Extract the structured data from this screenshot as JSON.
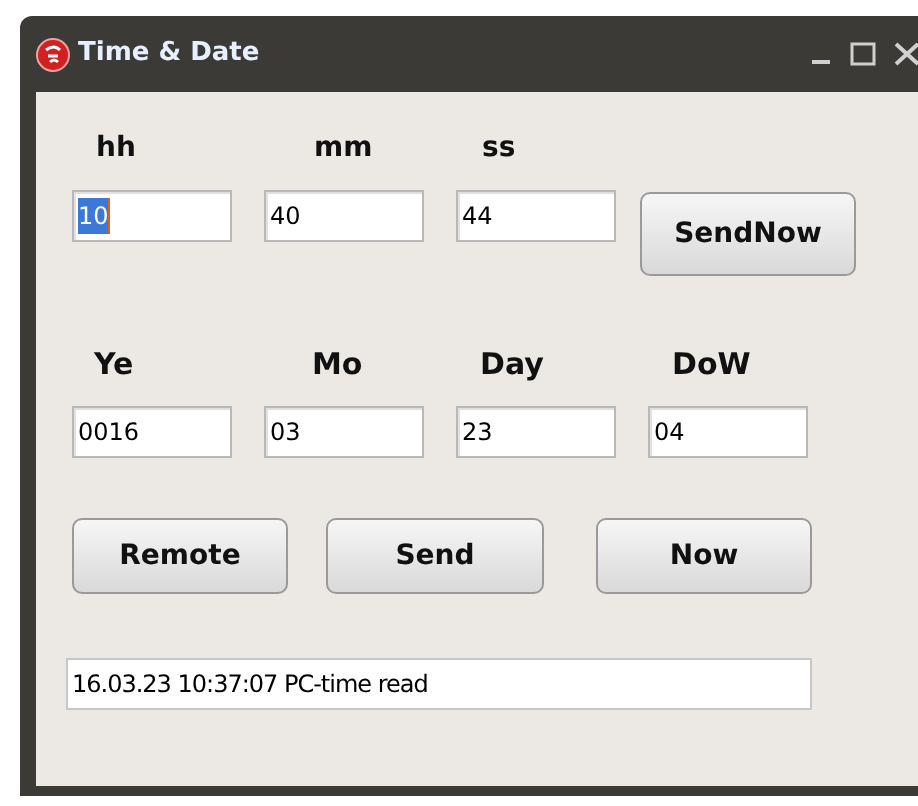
{
  "window": {
    "title": "Time & Date"
  },
  "time_labels": [
    "hh",
    "mm",
    "ss"
  ],
  "time_fields": [
    {
      "value": "10",
      "highlighted": true
    },
    {
      "value": "40",
      "highlighted": false
    },
    {
      "value": "44",
      "highlighted": false
    }
  ],
  "send_now_button": "SendNow",
  "date_labels": [
    "Ye",
    "Mo",
    "Day",
    "DoW"
  ],
  "date_fields": [
    {
      "value": "0016",
      "highlighted": false
    },
    {
      "value": "03",
      "highlighted": false
    },
    {
      "value": "23",
      "highlighted": false
    },
    {
      "value": "04",
      "highlighted": false
    }
  ],
  "buttons": [
    "Remote",
    "Send",
    "Now"
  ],
  "status": "16.03.23 10:37:07 PC-time read"
}
